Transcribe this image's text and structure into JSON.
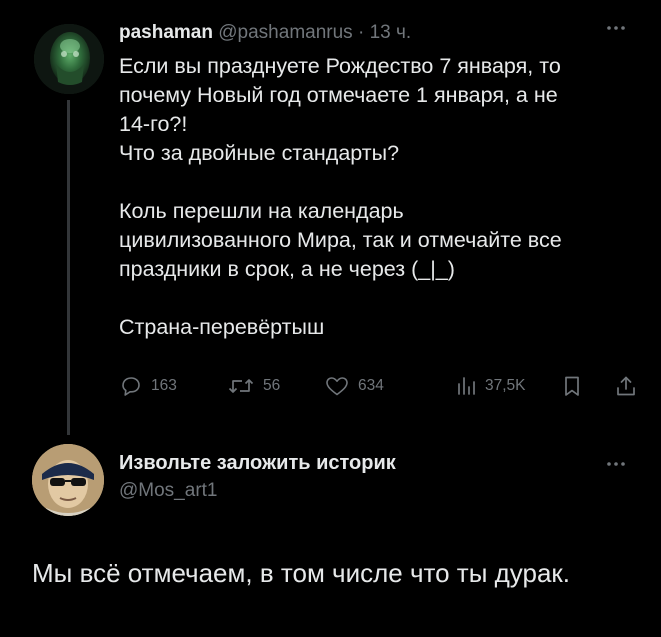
{
  "original_tweet": {
    "author_name": "pashaman",
    "handle": "@pashamanrus",
    "separator": "·",
    "time": "13 ч.",
    "text_lines": [
      "Если вы празднуете Рождество 7 января, то",
      "почему Новый год отмечаете 1 января, а не",
      "14-го?!",
      "Что за двойные стандарты?",
      "",
      "Коль перешли на календарь",
      "цивилизованного Мира, так и отмечайте все",
      "праздники в срок, а не через (_|_)",
      "",
      "Страна-перевёртыш"
    ],
    "actions": {
      "replies": "163",
      "retweets": "56",
      "likes": "634",
      "views": "37,5K"
    }
  },
  "reply_tweet": {
    "author_name": "Извольте заложить историк",
    "handle": "@Mos_art1",
    "text": "Мы всё отмечаем, в том числе что ты дурак."
  },
  "colors": {
    "background": "#000000",
    "primary_text": "#e7e9ea",
    "secondary_text": "#71767b",
    "thread_line": "#333639"
  }
}
